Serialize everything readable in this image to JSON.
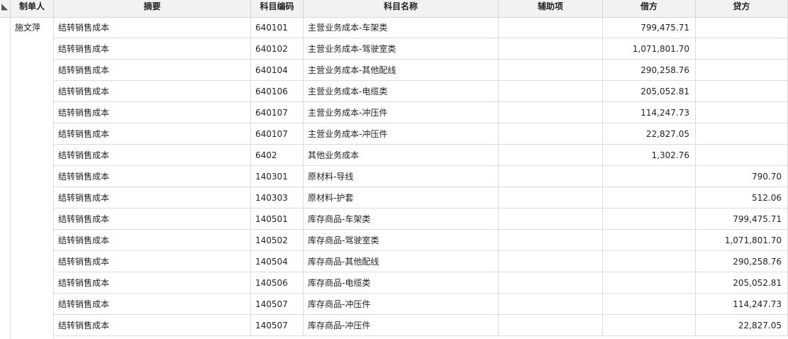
{
  "columns": {
    "marker": "◣",
    "preparer": "制单人",
    "summary": "摘要",
    "account_code": "科目编码",
    "account_name": "科目名称",
    "auxiliary": "辅助项",
    "debit": "借方",
    "credit": "贷方"
  },
  "preparer": "施文萍",
  "rows": [
    {
      "summary": "结转销售成本",
      "code": "640101",
      "name": "主营业务成本-车架类",
      "aux": "",
      "debit": "799,475.71",
      "credit": ""
    },
    {
      "summary": "结转销售成本",
      "code": "640102",
      "name": "主营业务成本-驾驶室类",
      "aux": "",
      "debit": "1,071,801.70",
      "credit": ""
    },
    {
      "summary": "结转销售成本",
      "code": "640104",
      "name": "主营业务成本-其他配线",
      "aux": "",
      "debit": "290,258.76",
      "credit": ""
    },
    {
      "summary": "结转销售成本",
      "code": "640106",
      "name": "主营业务成本-电缆类",
      "aux": "",
      "debit": "205,052.81",
      "credit": ""
    },
    {
      "summary": "结转销售成本",
      "code": "640107",
      "name": "主营业务成本-冲压件",
      "aux": "",
      "debit": "114,247.73",
      "credit": ""
    },
    {
      "summary": "结转销售成本",
      "code": "640107",
      "name": "主营业务成本-冲压件",
      "aux": "",
      "debit": "22,827.05",
      "credit": ""
    },
    {
      "summary": "结转销售成本",
      "code": "6402",
      "name": "其他业务成本",
      "aux": "",
      "debit": "1,302.76",
      "credit": ""
    },
    {
      "summary": "结转销售成本",
      "code": "140301",
      "name": "原材料-导线",
      "aux": "",
      "debit": "",
      "credit": "790.70"
    },
    {
      "summary": "结转销售成本",
      "code": "140303",
      "name": "原材料-护套",
      "aux": "",
      "debit": "",
      "credit": "512.06"
    },
    {
      "summary": "结转销售成本",
      "code": "140501",
      "name": "库存商品-车架类",
      "aux": "",
      "debit": "",
      "credit": "799,475.71"
    },
    {
      "summary": "结转销售成本",
      "code": "140502",
      "name": "库存商品-驾驶室类",
      "aux": "",
      "debit": "",
      "credit": "1,071,801.70"
    },
    {
      "summary": "结转销售成本",
      "code": "140504",
      "name": "库存商品-其他配线",
      "aux": "",
      "debit": "",
      "credit": "290,258.76"
    },
    {
      "summary": "结转销售成本",
      "code": "140506",
      "name": "库存商品-电缆类",
      "aux": "",
      "debit": "",
      "credit": "205,052.81"
    },
    {
      "summary": "结转销售成本",
      "code": "140507",
      "name": "库存商品-冲压件",
      "aux": "",
      "debit": "",
      "credit": "114,247.73"
    },
    {
      "summary": "结转销售成本",
      "code": "140507",
      "name": "库存商品-冲压件",
      "aux": "",
      "debit": "",
      "credit": "22,827.05"
    }
  ]
}
